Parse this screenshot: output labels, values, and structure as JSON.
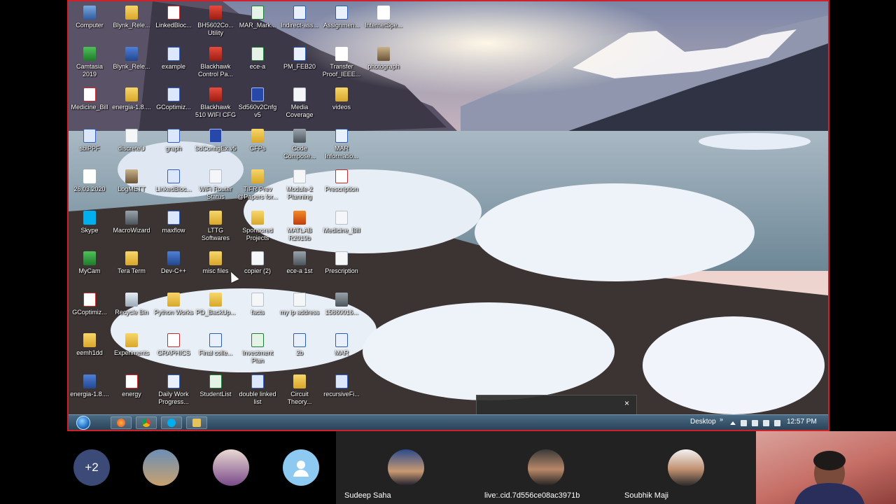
{
  "desktop": {
    "icons": [
      {
        "label": "Computer",
        "kind": "pc",
        "col": 0,
        "row": 0
      },
      {
        "label": "Blynk_Rele...",
        "kind": "folder",
        "col": 1,
        "row": 0
      },
      {
        "label": "LinkedBloc...",
        "kind": "pdf",
        "col": 2,
        "row": 0
      },
      {
        "label": "BH5602Co... Utility",
        "kind": "red",
        "col": 3,
        "row": 0
      },
      {
        "label": "MAR_Mark...",
        "kind": "excel",
        "col": 4,
        "row": 0
      },
      {
        "label": "Indirect-ass...",
        "kind": "word",
        "col": 5,
        "row": 0
      },
      {
        "label": "Assignmen...",
        "kind": "word",
        "col": 6,
        "row": 0
      },
      {
        "label": "InternetSpe...",
        "kind": "blank",
        "col": 7,
        "row": 0
      },
      {
        "label": "Camtasia 2019",
        "kind": "green",
        "col": 0,
        "row": 1
      },
      {
        "label": "Blynk_Rele...",
        "kind": "app",
        "col": 1,
        "row": 1
      },
      {
        "label": "example",
        "kind": "cpp",
        "col": 2,
        "row": 1
      },
      {
        "label": "Blackhawk Control Pa...",
        "kind": "red",
        "col": 3,
        "row": 1
      },
      {
        "label": "ece-a",
        "kind": "excel",
        "col": 4,
        "row": 1
      },
      {
        "label": "PM_FEB20",
        "kind": "word",
        "col": 5,
        "row": 1
      },
      {
        "label": "Transfer Proof_IEEE...",
        "kind": "blank",
        "col": 6,
        "row": 1
      },
      {
        "label": "photograph",
        "kind": "photo",
        "col": 7,
        "row": 1
      },
      {
        "label": "Medicine_Bill",
        "kind": "pdf",
        "col": 0,
        "row": 2
      },
      {
        "label": "energia-1.8....",
        "kind": "folder",
        "col": 1,
        "row": 2
      },
      {
        "label": "GCoptimiz...",
        "kind": "cpp",
        "col": 2,
        "row": 2
      },
      {
        "label": "Blackhawk 510 WIFI CFG",
        "kind": "red",
        "col": 3,
        "row": 2
      },
      {
        "label": "Sd560v2Cnfg v5",
        "kind": "sd",
        "col": 4,
        "row": 2
      },
      {
        "label": "Media Coverage",
        "kind": "file",
        "col": 5,
        "row": 2
      },
      {
        "label": "videos",
        "kind": "folder",
        "col": 6,
        "row": 2
      },
      {
        "label": "sbiPPF",
        "kind": "cpp",
        "col": 0,
        "row": 3
      },
      {
        "label": "discreteU",
        "kind": "file",
        "col": 1,
        "row": 3
      },
      {
        "label": "graph",
        "kind": "cpp",
        "col": 2,
        "row": 3
      },
      {
        "label": "SdConfigEx v5",
        "kind": "sd",
        "col": 3,
        "row": 3
      },
      {
        "label": "CFPs",
        "kind": "folder",
        "col": 4,
        "row": 3
      },
      {
        "label": "Code Compose...",
        "kind": "gray",
        "col": 5,
        "row": 3
      },
      {
        "label": "MAR Informatio...",
        "kind": "word",
        "col": 6,
        "row": 3
      },
      {
        "label": "26.03.2020",
        "kind": "blank",
        "col": 0,
        "row": 4
      },
      {
        "label": "LogMETT",
        "kind": "photo",
        "col": 1,
        "row": 4
      },
      {
        "label": "LinkedBloc...",
        "kind": "cpp",
        "col": 2,
        "row": 4
      },
      {
        "label": "WiFi Router Status",
        "kind": "file",
        "col": 3,
        "row": 4
      },
      {
        "label": "TIFR Prev @Papers for...",
        "kind": "folder",
        "col": 4,
        "row": 4
      },
      {
        "label": "Module-2 Planning",
        "kind": "file",
        "col": 5,
        "row": 4
      },
      {
        "label": "Prescription",
        "kind": "pdf",
        "col": 6,
        "row": 4
      },
      {
        "label": "Skype",
        "kind": "skype",
        "col": 0,
        "row": 5
      },
      {
        "label": "MacroWizard",
        "kind": "gray",
        "col": 1,
        "row": 5
      },
      {
        "label": "maxflow",
        "kind": "cpp",
        "col": 2,
        "row": 5
      },
      {
        "label": "LTTG Softwares",
        "kind": "folder",
        "col": 3,
        "row": 5
      },
      {
        "label": "Sponsored Projects",
        "kind": "folder",
        "col": 4,
        "row": 5
      },
      {
        "label": "MATLAB R2019b",
        "kind": "matlab",
        "col": 5,
        "row": 5
      },
      {
        "label": "Medicine_Bill",
        "kind": "file",
        "col": 6,
        "row": 5
      },
      {
        "label": "MyCam",
        "kind": "green",
        "col": 0,
        "row": 6
      },
      {
        "label": "Tera Term",
        "kind": "folder",
        "col": 1,
        "row": 6
      },
      {
        "label": "Dev-C++",
        "kind": "app",
        "col": 2,
        "row": 6
      },
      {
        "label": "misc files",
        "kind": "folder",
        "col": 3,
        "row": 6
      },
      {
        "label": "copier (2)",
        "kind": "file",
        "col": 4,
        "row": 6
      },
      {
        "label": "ece-a 1st",
        "kind": "gray",
        "col": 5,
        "row": 6
      },
      {
        "label": "Prescription",
        "kind": "file",
        "col": 6,
        "row": 6
      },
      {
        "label": "GCoptimiz...",
        "kind": "pdf",
        "col": 0,
        "row": 7
      },
      {
        "label": "Recycle Bin",
        "kind": "bin",
        "col": 1,
        "row": 7
      },
      {
        "label": "Python Works",
        "kind": "folder",
        "col": 2,
        "row": 7
      },
      {
        "label": "PD_BackUp...",
        "kind": "folder",
        "col": 3,
        "row": 7
      },
      {
        "label": "facts",
        "kind": "file",
        "col": 4,
        "row": 7
      },
      {
        "label": "my ip address",
        "kind": "file",
        "col": 5,
        "row": 7
      },
      {
        "label": "15860016...",
        "kind": "gray",
        "col": 6,
        "row": 7
      },
      {
        "label": "eemh1dd",
        "kind": "folder",
        "col": 0,
        "row": 8
      },
      {
        "label": "Experiments",
        "kind": "folder",
        "col": 1,
        "row": 8
      },
      {
        "label": "GRAPHICS",
        "kind": "pdf",
        "col": 2,
        "row": 8
      },
      {
        "label": "Final colle...",
        "kind": "word",
        "col": 3,
        "row": 8
      },
      {
        "label": "Investment Plan",
        "kind": "excel",
        "col": 4,
        "row": 8
      },
      {
        "label": "2b",
        "kind": "word",
        "col": 5,
        "row": 8
      },
      {
        "label": "MAR",
        "kind": "word",
        "col": 6,
        "row": 8
      },
      {
        "label": "energia-1.8....",
        "kind": "app",
        "col": 0,
        "row": 9
      },
      {
        "label": "energy",
        "kind": "pdf",
        "col": 1,
        "row": 9
      },
      {
        "label": "Daily Work Progress...",
        "kind": "word",
        "col": 2,
        "row": 9
      },
      {
        "label": "StudentList",
        "kind": "excel",
        "col": 3,
        "row": 9
      },
      {
        "label": "double linked list",
        "kind": "cpp",
        "col": 4,
        "row": 9
      },
      {
        "label": "Circuit Theory...",
        "kind": "folder",
        "col": 5,
        "row": 9
      },
      {
        "label": "recursiveFi...",
        "kind": "cpp",
        "col": 6,
        "row": 9
      }
    ]
  },
  "taskbar": {
    "desktop_label": "Desktop",
    "chevron": "»",
    "time": "12:57 PM",
    "pinned": [
      "firefox-icon",
      "chrome-icon",
      "skype-icon",
      "explorer-icon"
    ]
  },
  "popup": {
    "close": "×"
  },
  "participants": {
    "more_count": "+2",
    "named": [
      "Sudeep Saha",
      "live:.cid.7d556ce08ac3971b",
      "Soubhik Maji"
    ]
  },
  "colors": {
    "frame": "#d0202a",
    "more_circle": "#3c4a78"
  }
}
